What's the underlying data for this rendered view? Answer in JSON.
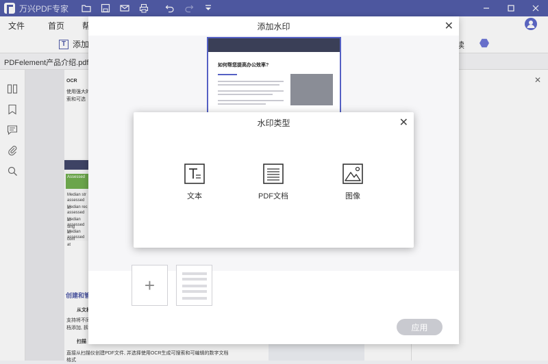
{
  "app": {
    "title": "万兴PDF专家"
  },
  "menu": {
    "items": [
      "文件",
      "首页",
      "帮助"
    ]
  },
  "toolbar": {
    "add_label": "添加",
    "read_label": "读"
  },
  "document": {
    "tab_label": "PDFelement产品介绍.pdf *",
    "snippets": {
      "ocr": "OCR",
      "ocr_body1": "使用强大的",
      "ocr_body2": "索和可选",
      "assessed1": "Assessed",
      "median1": "Median str",
      "assessed_at1": "assessed at",
      "median2": "Median rec",
      "assessed_at2": "assessed at",
      "median3": "Median sing",
      "assessed_at3": "assessed at",
      "median4": "Median com",
      "assessed_at4": "assessed at",
      "create_heading": "创建和管",
      "from_file": "从文档",
      "support": "支持将不同",
      "add_text": "档添加, 拆",
      "scan": "扫描",
      "scan_body": "直接从扫描仪创建PDF文件, 并选择使用OCR生成可搜索和可编辑的数字文档",
      "scan_body2": "格式"
    }
  },
  "watermark_dialog": {
    "title": "添加水印",
    "preview": {
      "heading": "如何帮您提高办公效率?"
    },
    "apply_label": "应用"
  },
  "type_dialog": {
    "title": "水印类型",
    "options": [
      {
        "label": "文本",
        "icon": "text-watermark-icon"
      },
      {
        "label": "PDF文档",
        "icon": "pdf-document-icon"
      },
      {
        "label": "图像",
        "icon": "image-icon"
      }
    ]
  },
  "colors": {
    "accent": "#4f5aa8",
    "titlebar": "#4f5aa8",
    "apply_disabled": "#c9cad0"
  }
}
